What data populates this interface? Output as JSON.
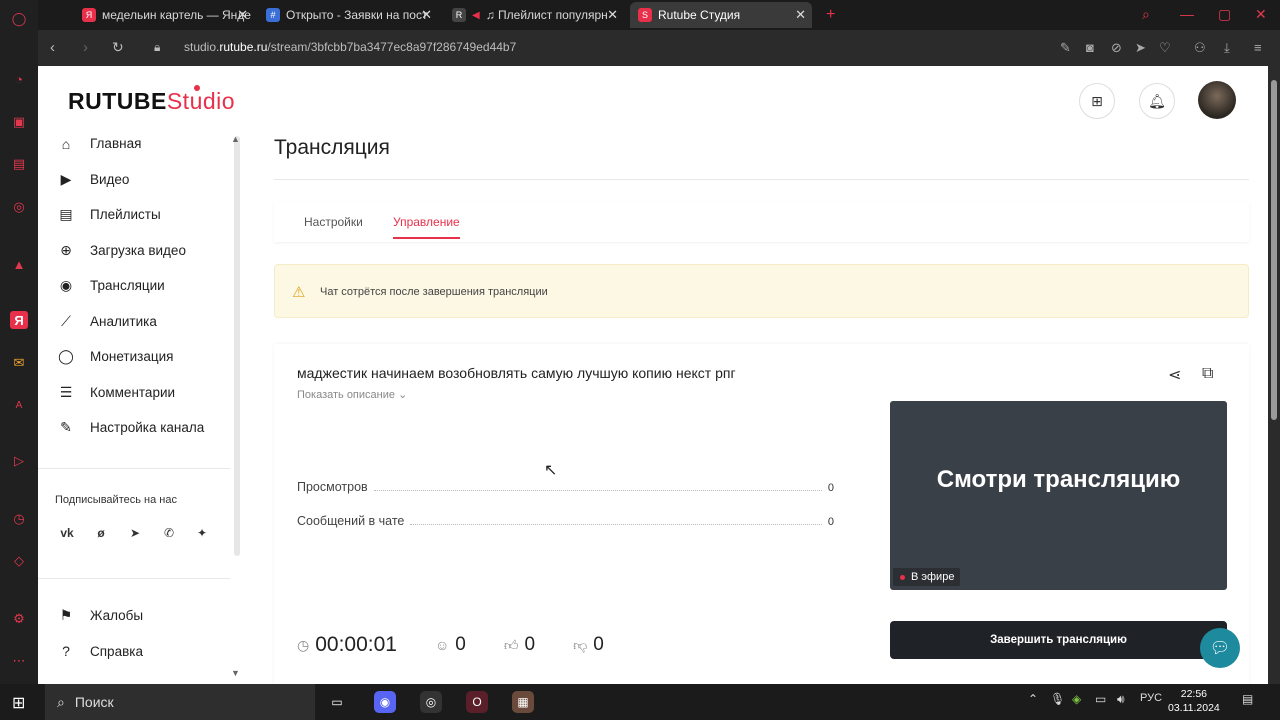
{
  "browser": {
    "tabs": [
      {
        "label": "медельин картель — Янде",
        "color": "#e8304a",
        "fav": "Я"
      },
      {
        "label": "Открыто - Заявки на пост",
        "color": "#3b6fd8",
        "fav": "#"
      },
      {
        "label": "♫ Плейлист популярн",
        "color": "#444444",
        "fav": "R"
      },
      {
        "label": "Rutube Студия",
        "color": "#e8304a",
        "fav": "S"
      }
    ],
    "new_tab": "+",
    "url_prefix": "studio.",
    "url_domain": "rutube.ru",
    "url_path": "/stream/3bfcbb7ba3477ec8a97f286749ed44b7"
  },
  "header": {
    "logo_main": "RUTUBE",
    "logo_studio": "Studio"
  },
  "sidebar": {
    "items": [
      {
        "label": "Главная",
        "icon": "home-icon",
        "glyph": "⌂"
      },
      {
        "label": "Видео",
        "icon": "video-icon",
        "glyph": "▶"
      },
      {
        "label": "Плейлисты",
        "icon": "playlist-icon",
        "glyph": "▤"
      },
      {
        "label": "Загрузка видео",
        "icon": "upload-icon",
        "glyph": "⊕"
      },
      {
        "label": "Трансляции",
        "icon": "broadcast-icon",
        "glyph": "◉"
      },
      {
        "label": "Аналитика",
        "icon": "analytics-icon",
        "glyph": "⟋"
      },
      {
        "label": "Монетизация",
        "icon": "monetization-icon",
        "glyph": "◯"
      },
      {
        "label": "Комментарии",
        "icon": "comments-icon",
        "glyph": "☰"
      },
      {
        "label": "Настройка канала",
        "icon": "magic-wand-icon",
        "glyph": "✎"
      }
    ],
    "follow_label": "Подписывайтесь на нас",
    "socials": [
      "vk",
      "ok",
      "telegram",
      "viber",
      "dzen"
    ],
    "bottom_items": [
      {
        "label": "Жалобы",
        "icon": "flag-icon",
        "glyph": "⚑"
      },
      {
        "label": "Справка",
        "icon": "help-icon",
        "glyph": "?"
      }
    ]
  },
  "main": {
    "title": "Трансляция",
    "tabs": [
      {
        "label": "Настройки"
      },
      {
        "label": "Управление"
      }
    ],
    "active_tab": "Управление",
    "warning": "Чат сотрётся после завершения трансляции",
    "stream_title": "маджестик начинаем возобновлять самую лучшую копию некст рпг",
    "show_description": "Показать описание",
    "stats": [
      {
        "label": "Просмотров",
        "value": "0"
      },
      {
        "label": "Сообщений в чате",
        "value": "0"
      }
    ],
    "preview_text": "Смотри трансляцию",
    "live_badge": "В эфире",
    "end_button": "Завершить трансляцию",
    "timer": "00:00:01",
    "viewers": "0",
    "likes": "0",
    "dislikes": "0"
  },
  "taskbar": {
    "search_label": "Поиск",
    "lang": "РУС",
    "time": "22:56",
    "date": "03.11.2024"
  }
}
